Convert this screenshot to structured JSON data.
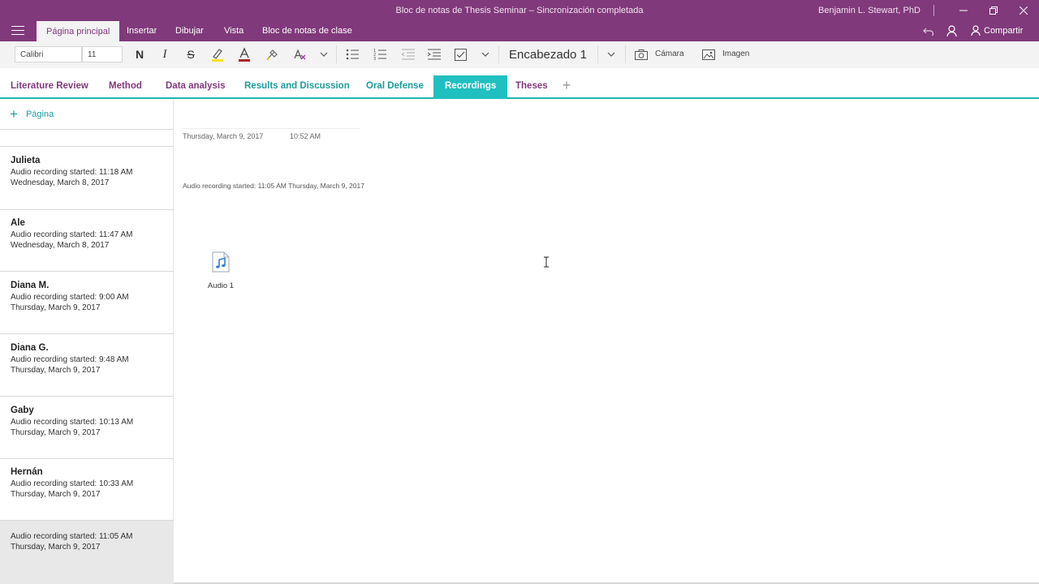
{
  "window": {
    "title": "Bloc de notas de Thesis Seminar – Sincronización completada",
    "user": "Benjamin L. Stewart, PhD",
    "share_label": "Compartir"
  },
  "ribbon_tabs": [
    "Página principal",
    "Insertar",
    "Dibujar",
    "Vista",
    "Bloc de notas de clase"
  ],
  "active_ribbon_tab": "Página principal",
  "toolbar": {
    "font_name": "Calibri",
    "font_size": "11",
    "bold_glyph": "N",
    "italic_glyph": "I",
    "strike_glyph": "S",
    "style_name": "Encabezado 1",
    "camera_label": "Cámara",
    "image_label": "Imagen"
  },
  "sections": [
    "Literature Review",
    "Method",
    "Data analysis",
    "Results and Discussion",
    "Oral Defense",
    "Recordings",
    "Theses"
  ],
  "section_colors": [
    "#80397b",
    "#80397b",
    "#80397b",
    "#1c9c9c",
    "#1c9c9c",
    "#ffffff",
    "#80397b"
  ],
  "active_section": "Recordings",
  "accent": "#80397b",
  "teal": "#20c0c0",
  "add_page_label": "Página",
  "pages": [
    {
      "title": "Julieta",
      "line1": "Audio recording started: 11:18 AM",
      "line2": "Wednesday, March 8, 2017"
    },
    {
      "title": "Ale",
      "line1": "Audio recording started: 11:47 AM",
      "line2": "Wednesday, March 8, 2017"
    },
    {
      "title": "Diana M.",
      "line1": "Audio recording started: 9:00 AM",
      "line2": "Thursday, March 9, 2017"
    },
    {
      "title": "Diana G.",
      "line1": "Audio recording started: 9:48 AM",
      "line2": "Thursday, March 9, 2017"
    },
    {
      "title": "Gaby",
      "line1": "Audio recording started: 10:13 AM",
      "line2": "Thursday, March 9, 2017"
    },
    {
      "title": "Hernán",
      "line1": "Audio recording started: 10:33 AM",
      "line2": "Thursday, March 9, 2017"
    },
    {
      "title": "",
      "line1": "Audio recording started: 11:05 AM",
      "line2": "Thursday, March 9, 2017"
    }
  ],
  "selected_page_index": 6,
  "canvas": {
    "date": "Thursday, March 9, 2017",
    "time": "10:52 AM",
    "recording_note": "Audio recording started: 11:05 AM Thursday, March 9, 2017",
    "audio_label": "Audio 1"
  }
}
